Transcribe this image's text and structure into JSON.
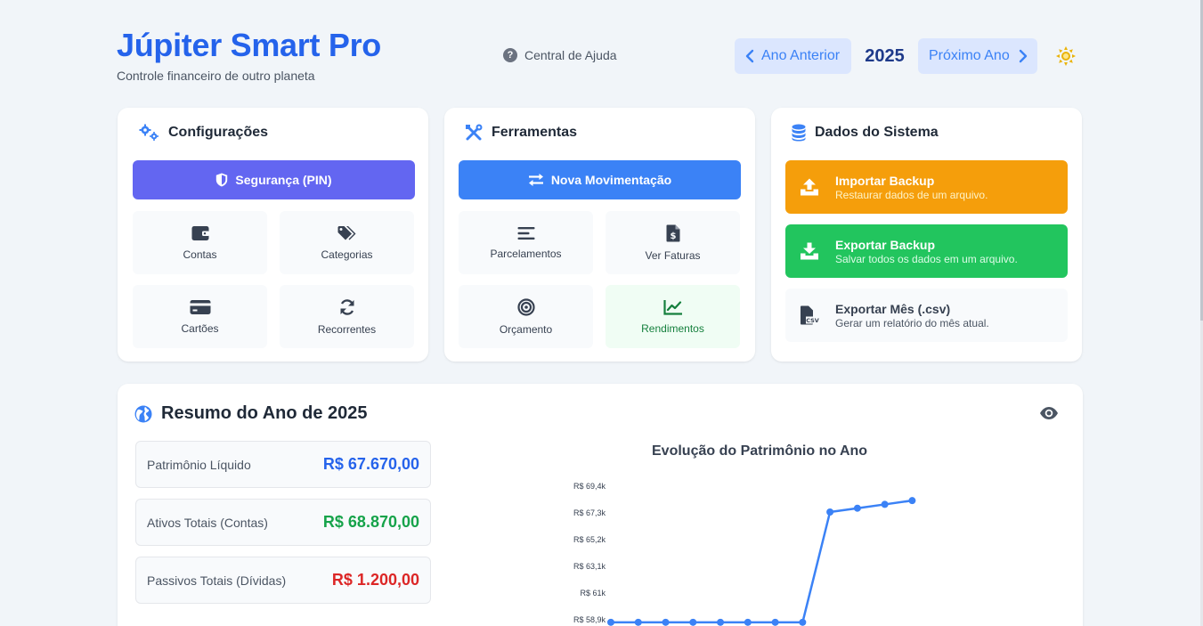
{
  "header": {
    "title": "Júpiter Smart Pro",
    "subtitle": "Controle financeiro de outro planeta",
    "help_label": "Central de Ajuda",
    "prev_year_label": "Ano Anterior",
    "year": "2025",
    "next_year_label": "Próximo Ano"
  },
  "config": {
    "title": "Configurações",
    "security_label": "Segurança (PIN)",
    "tiles": [
      "Contas",
      "Categorias",
      "Cartões",
      "Recorrentes"
    ]
  },
  "tools": {
    "title": "Ferramentas",
    "new_label": "Nova Movimentação",
    "tiles": [
      "Parcelamentos",
      "Ver Faturas",
      "Orçamento",
      "Rendimentos"
    ]
  },
  "system": {
    "title": "Dados do Sistema",
    "import_title": "Importar Backup",
    "import_desc": "Restaurar dados de um arquivo.",
    "export_title": "Exportar Backup",
    "export_desc": "Salvar todos os dados em um arquivo.",
    "csv_title": "Exportar Mês (.csv)",
    "csv_desc": "Gerar um relatório do mês atual.",
    "csv_icon_text": "CSV"
  },
  "summary": {
    "title": "Resumo do Ano de 2025",
    "equity_label": "Patrimônio Líquido",
    "equity_value": "R$ 67.670,00",
    "assets_label": "Ativos Totais (Contas)",
    "assets_value": "R$ 68.870,00",
    "liabilities_label": "Passivos Totais (Dívidas)",
    "liabilities_value": "R$ 1.200,00"
  },
  "colors": {
    "brand": "#2563eb",
    "security": "#6366f1",
    "primary": "#3b82f6",
    "import": "#f59e0b",
    "export": "#22c55e",
    "positive": "#16a34a",
    "negative": "#dc2626",
    "line": "#3b82f6"
  },
  "chart_data": {
    "type": "line",
    "title": "Evolução do Patrimônio no Ano",
    "y_tick_labels": [
      "R$ 69,4k",
      "R$ 67,3k",
      "R$ 65,2k",
      "R$ 63,1k",
      "R$ 61k",
      "R$ 58,9k"
    ],
    "y_ticks": [
      69400,
      67300,
      65200,
      63100,
      61000,
      58900
    ],
    "ylim": [
      58900,
      69400
    ],
    "series": [
      {
        "values": [
          58700,
          58700,
          58700,
          58700,
          58700,
          58700,
          58700,
          58700,
          67370,
          67670,
          67970,
          68270
        ]
      }
    ],
    "grid": false
  }
}
